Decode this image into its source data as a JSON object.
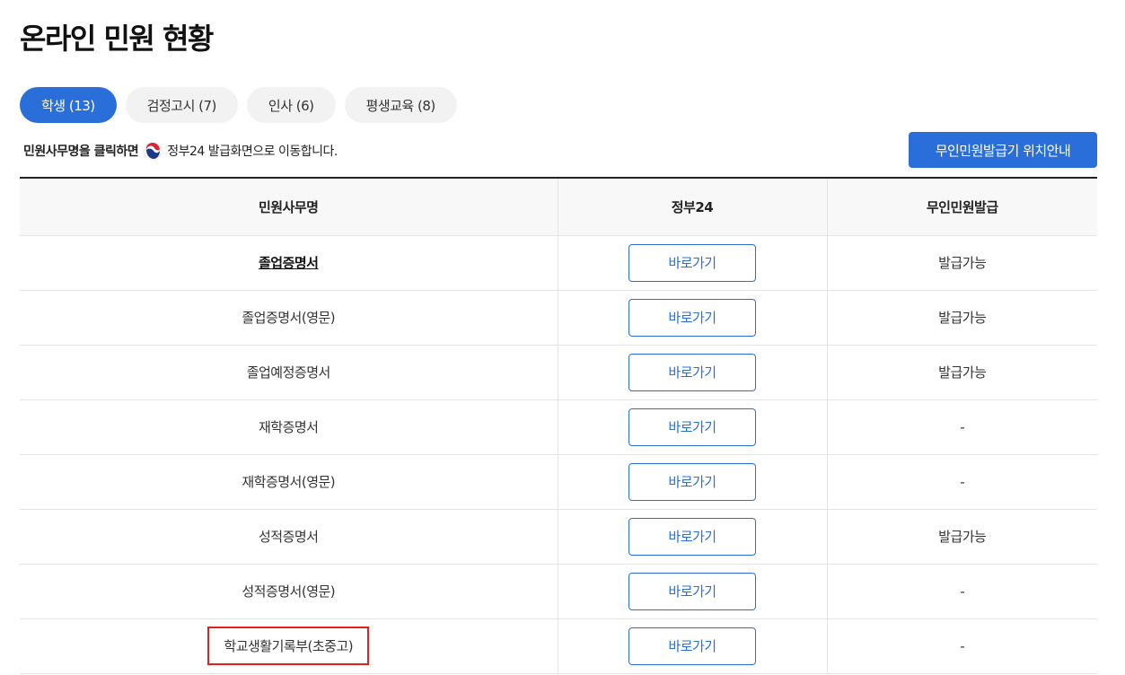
{
  "page_title": "온라인 민원 현황",
  "tabs": [
    {
      "label": "학생 (13)",
      "active": true
    },
    {
      "label": "검정고시 (7)",
      "active": false
    },
    {
      "label": "인사 (6)",
      "active": false
    },
    {
      "label": "평생교육 (8)",
      "active": false
    }
  ],
  "notice": {
    "lead": "민원사무명을 클릭하면",
    "tail": "정부24 발급화면으로 이동합니다."
  },
  "kiosk_button": "무인민원발급기 위치안내",
  "table": {
    "headers": [
      "민원사무명",
      "정부24",
      "무인민원발급"
    ],
    "rows": [
      {
        "name": "졸업증명서",
        "go": "바로가기",
        "kiosk": "발급가능"
      },
      {
        "name": "졸업증명서(영문)",
        "go": "바로가기",
        "kiosk": "발급가능"
      },
      {
        "name": "졸업예정증명서",
        "go": "바로가기",
        "kiosk": "발급가능"
      },
      {
        "name": "재학증명서",
        "go": "바로가기",
        "kiosk": "-"
      },
      {
        "name": "재학증명서(영문)",
        "go": "바로가기",
        "kiosk": "-"
      },
      {
        "name": "성적증명서",
        "go": "바로가기",
        "kiosk": "발급가능"
      },
      {
        "name": "성적증명서(영문)",
        "go": "바로가기",
        "kiosk": "-"
      },
      {
        "name": "학교생활기록부(초중고)",
        "go": "바로가기",
        "kiosk": "-"
      }
    ]
  },
  "colors": {
    "accent": "#2a6fd9",
    "highlight": "#e21f1f"
  }
}
